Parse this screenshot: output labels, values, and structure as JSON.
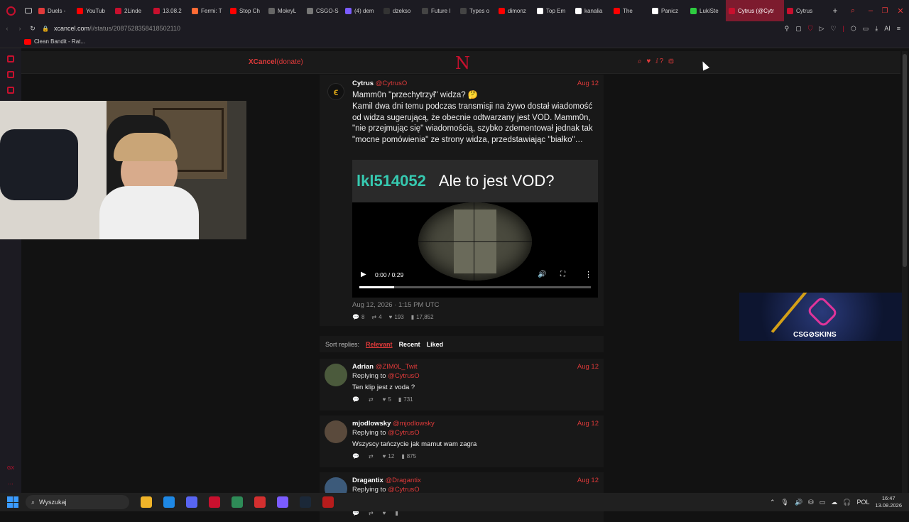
{
  "browser": {
    "tabs": [
      {
        "label": "Duels -",
        "color": "#e03a3a"
      },
      {
        "label": "YouTub",
        "color": "#ff0000"
      },
      {
        "label": "2Linde",
        "color": "#c8102e"
      },
      {
        "label": "13.08.2",
        "color": "#c8102e"
      },
      {
        "label": "Fermi: T",
        "color": "#ff6b35"
      },
      {
        "label": "Stop Ch",
        "color": "#ff0000"
      },
      {
        "label": "MokryL",
        "color": "#666"
      },
      {
        "label": "CSGO-S",
        "color": "#777"
      },
      {
        "label": "(4) dem",
        "color": "#7b5cff"
      },
      {
        "label": "dzekso",
        "color": "#333"
      },
      {
        "label": "Future I",
        "color": "#444"
      },
      {
        "label": "Types o",
        "color": "#444"
      },
      {
        "label": "dimonz",
        "color": "#ff0000"
      },
      {
        "label": "Top Em",
        "color": "#fff"
      },
      {
        "label": "kanalia",
        "color": "#fff"
      },
      {
        "label": "The",
        "color": "#ff0000"
      },
      {
        "label": "Panicz",
        "color": "#fff"
      },
      {
        "label": "LukiSte",
        "color": "#2ecc40"
      },
      {
        "label": "Cytrus (@Cytr",
        "color": "#c8102e"
      },
      {
        "label": "Cytrus",
        "color": "#c8102e"
      }
    ],
    "active_tab_index": 18,
    "url_domain": "xcancel.com",
    "url_path": "/i/status/2087528358418502110",
    "bookmark": "Clean Bandit - Rat...",
    "ai_label": "AI"
  },
  "site": {
    "brand": "XCancel",
    "donate": "(donate)",
    "logo": "N",
    "header_icons": "⌕ ♥ ⅈ? ⚙"
  },
  "tweet": {
    "name": "Cytrus",
    "handle": "@CytrusO",
    "date": "Aug 12",
    "title_line": "Mamm0n \"przechytrzył\" widza? 🤔",
    "body": "Kamil dwa dni temu podczas transmisji na żywo dostał wiadomość od widza sugerującą, że obecnie odtwarzany jest VOD. Mamm0n, \"nie przejmując się\" wiadomością, szybko zdementował jednak tak \"mocne pomówienia\" ze strony widza, przedstawiając \"białko\"…",
    "video_user": "lkl514052",
    "video_msg": "Ale to jest VOD?",
    "video_time": "0:00 / 0:29",
    "video_progress": 0.15,
    "timestamp": "Aug 12, 2026 · 1:15 PM UTC",
    "stats": {
      "replies": "8",
      "retweets": "4",
      "likes": "193",
      "views": "17,852"
    }
  },
  "sort": {
    "label": "Sort replies:",
    "options": [
      "Relevant",
      "Recent",
      "Liked"
    ],
    "active": "Relevant"
  },
  "replies": [
    {
      "name": "Adrian",
      "handle": "@ZIM0L_Twit",
      "date": "Aug 12",
      "replying": "Replying to",
      "to": "@CytrusO",
      "text": "Ten klip jest z voda ?",
      "replies": "",
      "retweets": "",
      "likes": "5",
      "views": "731"
    },
    {
      "name": "mjodlowsky",
      "handle": "@mjodlowsky",
      "date": "Aug 12",
      "replying": "Replying to",
      "to": "@CytrusO",
      "text": "Wszyscy tańczycie jak mamut wam zagra",
      "replies": "",
      "retweets": "",
      "likes": "12",
      "views": "875"
    },
    {
      "name": "Dragantix",
      "handle": "@Dragantix",
      "date": "Aug 12",
      "replying": "Replying to",
      "to": "@CytrusO",
      "text": "",
      "replies": "",
      "retweets": "",
      "likes": "",
      "views": ""
    }
  ],
  "ad": {
    "text": "CSG⊘SKINS"
  },
  "taskbar": {
    "search_placeholder": "Wyszukaj",
    "lang": "POL",
    "time": "16:47",
    "date": "13.08.2026",
    "icons": [
      {
        "name": "file-explorer-icon",
        "color": "#f0b429"
      },
      {
        "name": "app-m-icon",
        "color": "#1e88e5"
      },
      {
        "name": "discord-icon",
        "color": "#5865f2"
      },
      {
        "name": "opera-gx-icon",
        "color": "#c8102e"
      },
      {
        "name": "globe-icon",
        "color": "#2e8b57"
      },
      {
        "name": "app-red-icon",
        "color": "#d32f2f"
      },
      {
        "name": "app-purple-icon",
        "color": "#7b5cff"
      },
      {
        "name": "steam-icon",
        "color": "#1b2838"
      },
      {
        "name": "shield-app-icon",
        "color": "#b71c1c"
      }
    ]
  },
  "sidebar": {
    "gx_label": "GX",
    "more_label": "..."
  }
}
